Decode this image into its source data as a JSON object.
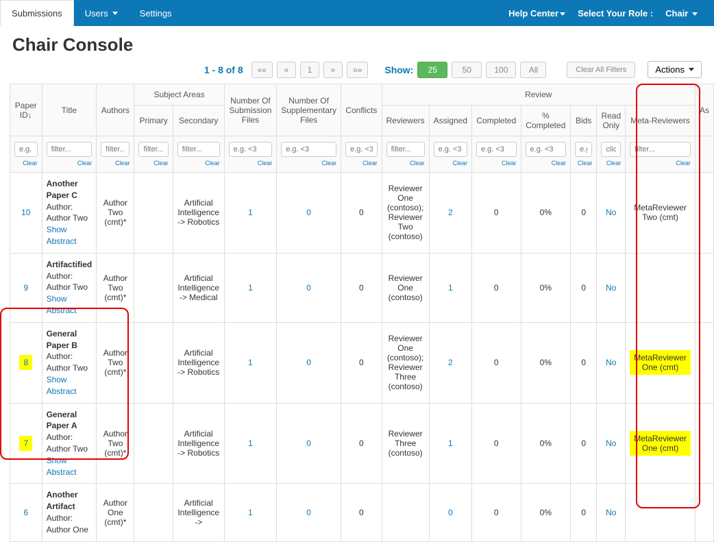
{
  "nav": {
    "tabs": [
      "Submissions",
      "Users",
      "Settings"
    ],
    "help": "Help Center",
    "role_label": "Select Your Role :",
    "role_value": "Chair"
  },
  "page_title": "Chair Console",
  "pager": {
    "label": "1 - 8 of 8",
    "first": "««",
    "prev": "«",
    "page": "1",
    "next": "»",
    "last": "»»"
  },
  "show": {
    "label": "Show:",
    "opts": [
      "25",
      "50",
      "100",
      "All"
    ],
    "active": 0
  },
  "clear_all": "Clear All Filters",
  "actions": "Actions",
  "headers": {
    "paper_id": "Paper ID",
    "title": "Title",
    "authors": "Authors",
    "subject_areas": "Subject Areas",
    "primary": "Primary",
    "secondary": "Secondary",
    "nsf": "Number Of Submission Files",
    "nsup": "Number Of Supplementary Files",
    "conflicts": "Conflicts",
    "review": "Review",
    "reviewers": "Reviewers",
    "assigned": "Assigned",
    "completed": "Completed",
    "pct": "% Completed",
    "bids": "Bids",
    "read_only": "Read Only",
    "meta": "Meta-Reviewers",
    "as": "As"
  },
  "filters": {
    "eg": "e.g. <3",
    "egdot": "e.g. .",
    "egshort": "e.g",
    "filter": "filter...",
    "click": "click",
    "clear": "Clear"
  },
  "rows": [
    {
      "id": "10",
      "id_hl": false,
      "title": "Another Paper C",
      "author_label": "Author:",
      "author_name": "Author Two",
      "show_abs": "Show Abstract",
      "authors": "Author Two (cmt)*",
      "secondary": "Artificial Intelligence -> Robotics",
      "nsf": "1",
      "nsup": "0",
      "conf": "0",
      "reviewers": "Reviewer One (contoso); Reviewer Two (contoso)",
      "assigned": "2",
      "completed": "0",
      "pct": "0%",
      "bids": "0",
      "ro": "No",
      "meta": "MetaReviewer Two (cmt)",
      "meta_hl": false
    },
    {
      "id": "9",
      "id_hl": false,
      "title": "Artifactified",
      "author_label": "Author:",
      "author_name": "Author Two",
      "show_abs": "Show Abstract",
      "authors": "Author Two (cmt)*",
      "secondary": "Artificial Intelligence -> Medical",
      "nsf": "1",
      "nsup": "0",
      "conf": "0",
      "reviewers": "Reviewer One (contoso)",
      "assigned": "1",
      "completed": "0",
      "pct": "0%",
      "bids": "0",
      "ro": "No",
      "meta": "",
      "meta_hl": false
    },
    {
      "id": "8",
      "id_hl": true,
      "title": "General Paper B",
      "author_label": "Author:",
      "author_name": "Author Two",
      "show_abs": "Show Abstract",
      "authors": "Author Two (cmt)*",
      "secondary": "Artificial Intelligence -> Robotics",
      "nsf": "1",
      "nsup": "0",
      "conf": "0",
      "reviewers": "Reviewer One (contoso); Reviewer Three (contoso)",
      "assigned": "2",
      "completed": "0",
      "pct": "0%",
      "bids": "0",
      "ro": "No",
      "meta": "MetaReviewer One (cmt)",
      "meta_hl": true
    },
    {
      "id": "7",
      "id_hl": true,
      "title": "General Paper A",
      "author_label": "Author:",
      "author_name": "Author Two",
      "show_abs": "Show Abstract",
      "authors": "Author Two (cmt)*",
      "secondary": "Artificial Intelligence -> Robotics",
      "nsf": "1",
      "nsup": "0",
      "conf": "0",
      "reviewers": "Reviewer Three (contoso)",
      "assigned": "1",
      "completed": "0",
      "pct": "0%",
      "bids": "0",
      "ro": "No",
      "meta": "MetaReviewer One (cmt)",
      "meta_hl": true
    },
    {
      "id": "6",
      "id_hl": false,
      "title": "Another Artifact",
      "author_label": "Author:",
      "author_name": "Author One",
      "show_abs": "",
      "authors": "Author One (cmt)*",
      "secondary": "Artificial Intelligence ->",
      "nsf": "1",
      "nsup": "0",
      "conf": "0",
      "reviewers": "",
      "assigned": "0",
      "completed": "0",
      "pct": "0%",
      "bids": "0",
      "ro": "No",
      "meta": "",
      "meta_hl": false
    }
  ]
}
